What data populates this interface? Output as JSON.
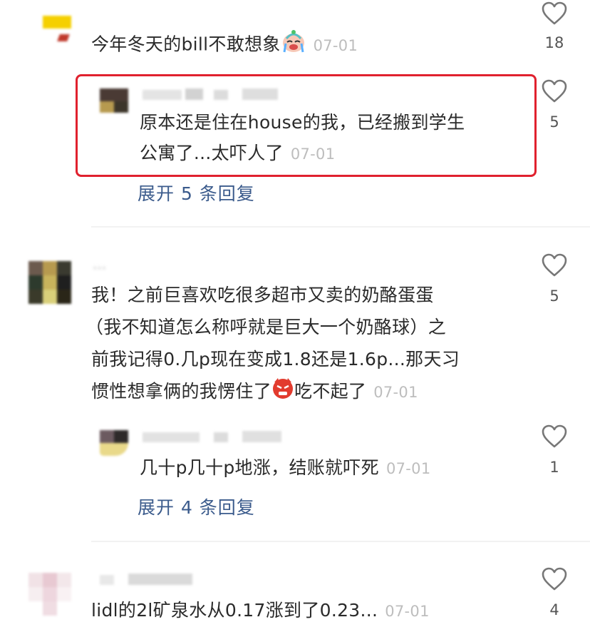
{
  "comments": [
    {
      "text": "今年冬天的bill不敢想象",
      "emoji": "crying-face",
      "date": "07-01",
      "likes": "18",
      "reply": {
        "text_line1": "原本还是住在house的我，已经搬到学生",
        "text_line2": "公寓了...太吓人了",
        "date": "07-01",
        "likes": "5"
      },
      "expand_label": "展开 5 条回复"
    },
    {
      "username": "...",
      "text_line1": "我！之前巨喜欢吃很多超市又卖的奶酪蛋蛋",
      "text_line2": "（我不知道怎么称呼就是巨大一个奶酪球）之",
      "text_line3": "前我记得0.几p现在变成1.8还是1.6p...那天习",
      "text_line4a": "惯性想拿俩的我愣住了",
      "emoji": "angry-face",
      "text_line4b": "吃不起了",
      "date": "07-01",
      "likes": "5",
      "reply": {
        "text": "几十p几十p地涨，结账就吓死",
        "date": "07-01",
        "likes": "1"
      },
      "expand_label": "展开 4 条回复"
    },
    {
      "text": "lidl的2l矿泉水从0.17涨到了0.23...",
      "date": "07-01",
      "likes": "4"
    }
  ],
  "colors": {
    "highlight_border": "#e0212e",
    "link": "#3b5b8c",
    "date": "#bdbdbd"
  }
}
